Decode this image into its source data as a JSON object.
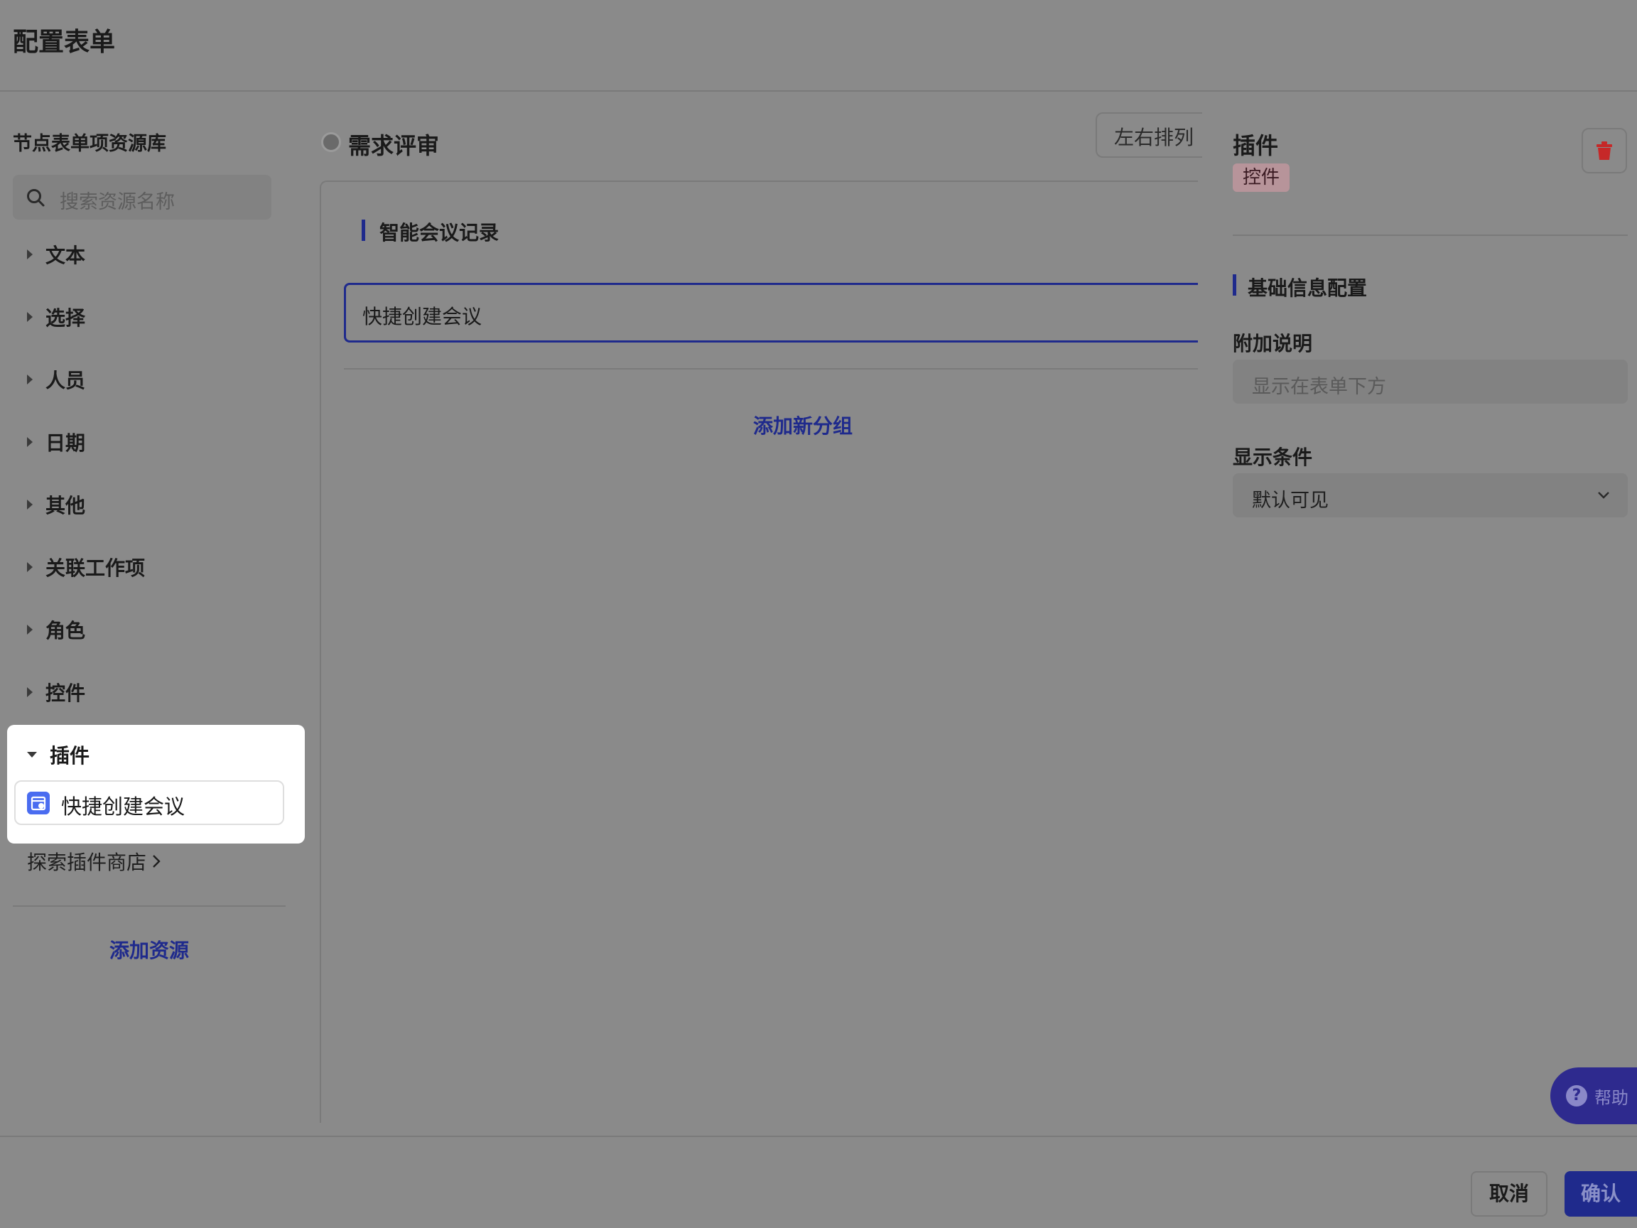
{
  "header": {
    "title": "配置表单"
  },
  "left": {
    "heading": "节点表单项资源库",
    "search": {
      "placeholder": "搜索资源名称"
    },
    "categories": [
      {
        "label": "文本",
        "expanded": false
      },
      {
        "label": "选择",
        "expanded": false
      },
      {
        "label": "人员",
        "expanded": false
      },
      {
        "label": "日期",
        "expanded": false
      },
      {
        "label": "其他",
        "expanded": false
      },
      {
        "label": "关联工作项",
        "expanded": false
      },
      {
        "label": "角色",
        "expanded": false
      },
      {
        "label": "控件",
        "expanded": false
      },
      {
        "label": "插件",
        "expanded": true
      }
    ],
    "plugin_item": {
      "label": "快捷创建会议",
      "icon": "calendar-plugin-icon"
    },
    "store_link": "探索插件商店",
    "add_resource": "添加资源"
  },
  "middle": {
    "title": "需求评审",
    "layout_button": "左右排列",
    "group_title": "智能会议记录",
    "field_label": "快捷创建会议",
    "add_group": "添加新分组"
  },
  "right": {
    "title": "插件",
    "badge": "控件",
    "section_title": "基础信息配置",
    "note_label": "附加说明",
    "note_placeholder": "显示在表单下方",
    "condition_label": "显示条件",
    "condition_value": "默认可见",
    "help": "帮助"
  },
  "footer": {
    "cancel": "取消",
    "confirm": "确认"
  },
  "colors": {
    "accent": "#1f2a8c",
    "overlay": "#8a8a8a",
    "delete": "#c62828",
    "plugin_icon": "#4a6cf0"
  }
}
